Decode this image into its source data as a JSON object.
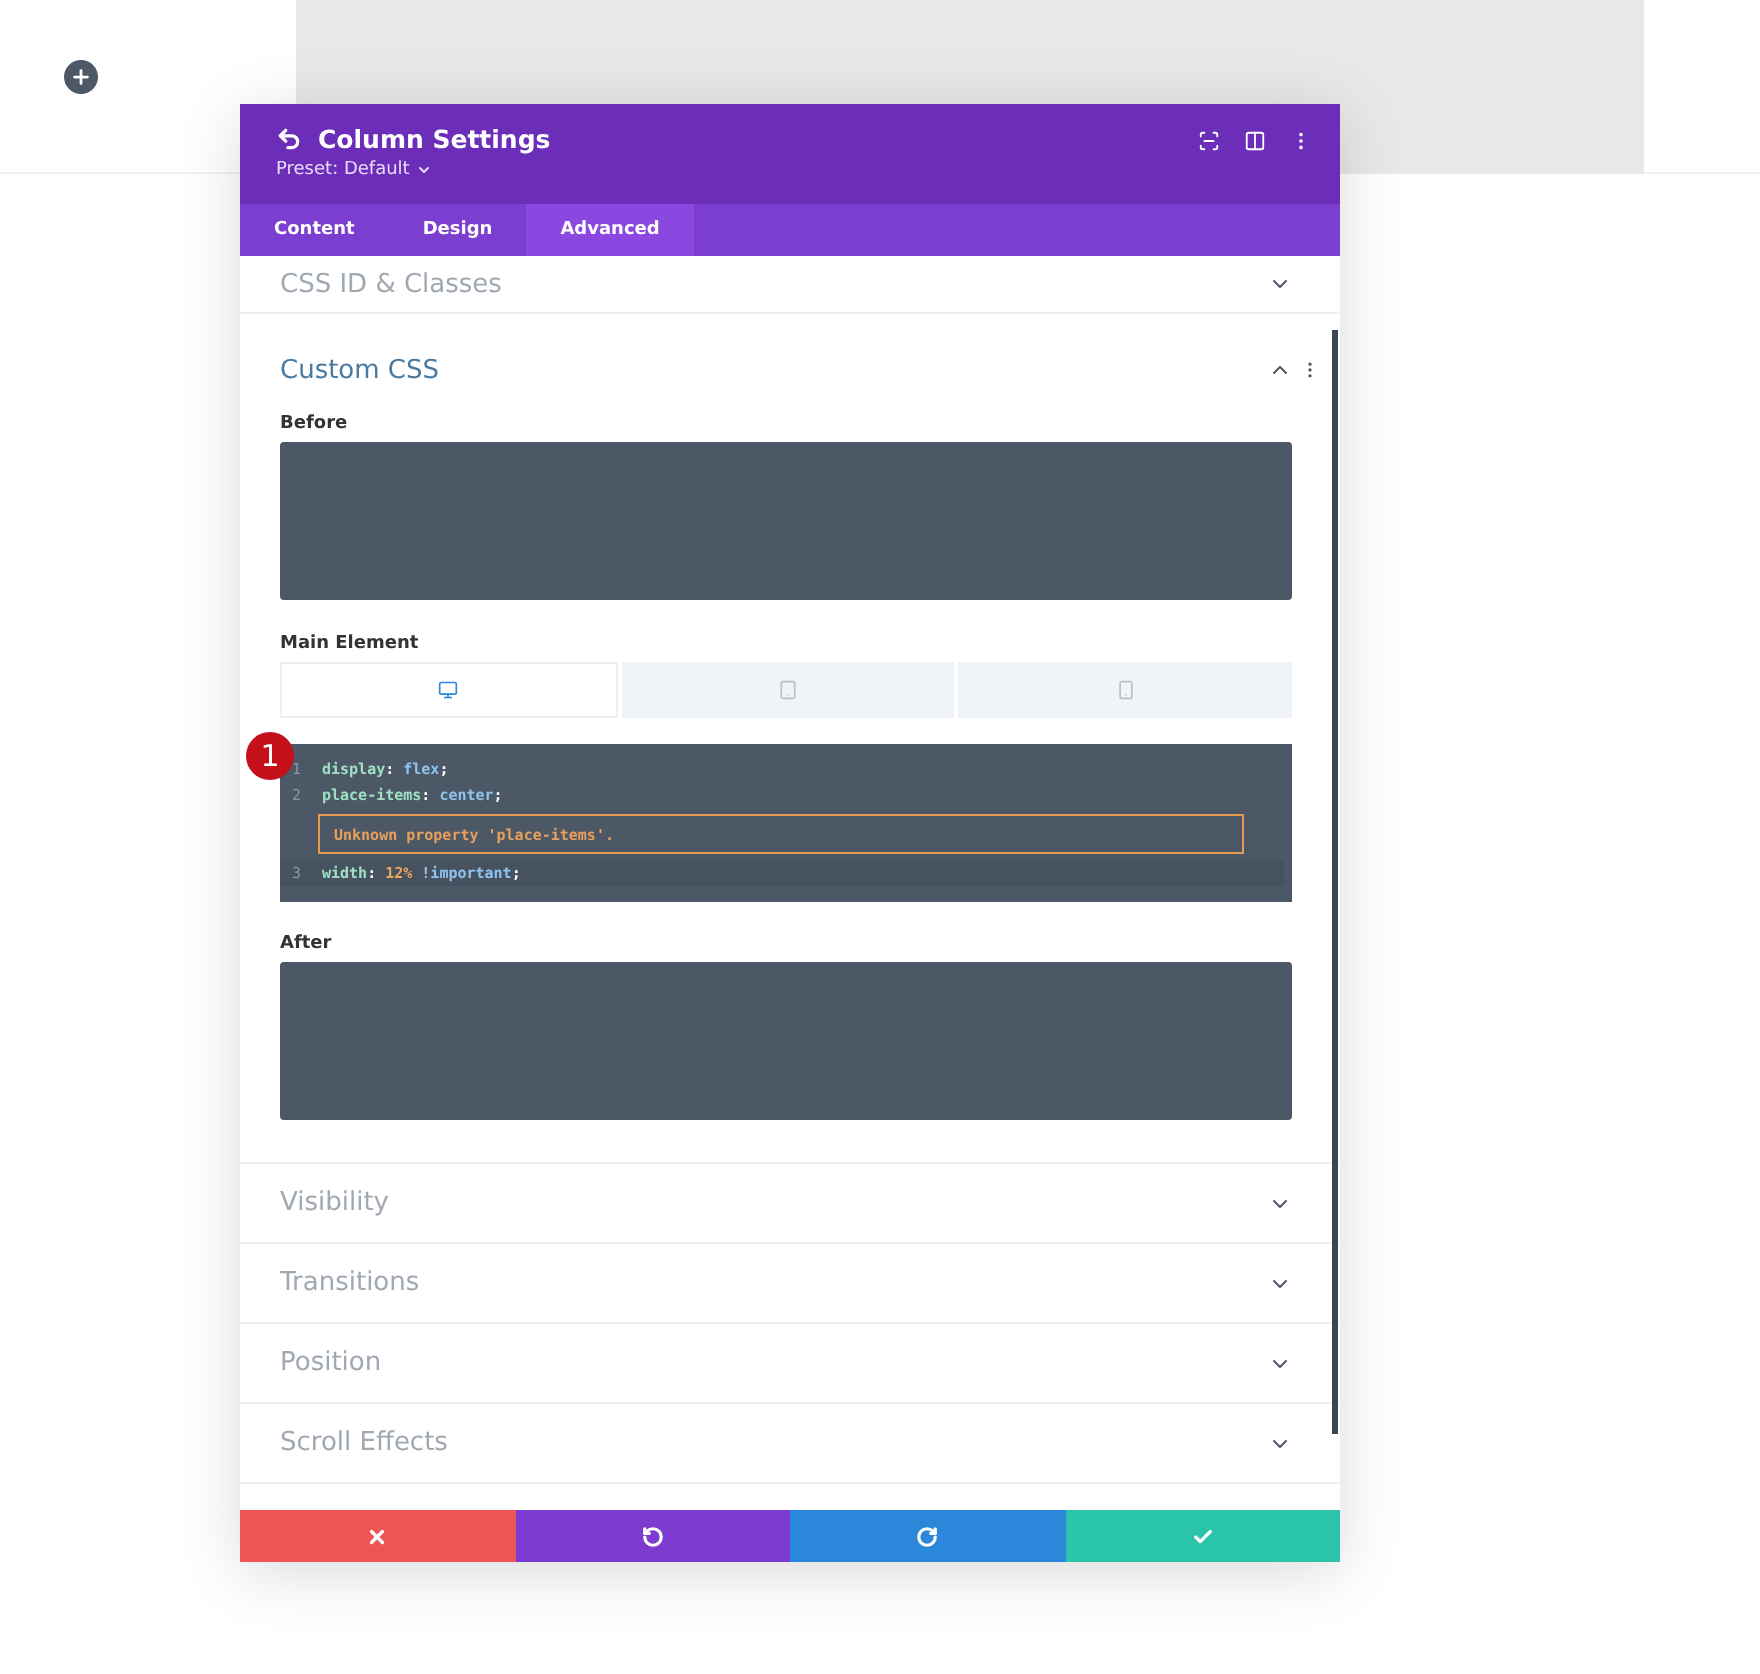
{
  "modal": {
    "title": "Column Settings",
    "preset": "Preset: Default",
    "tabs": [
      {
        "label": "Content",
        "selected": false
      },
      {
        "label": "Design",
        "selected": false
      },
      {
        "label": "Advanced",
        "selected": true
      }
    ],
    "sections_before": [
      {
        "title": "CSS ID & Classes",
        "expanded": false
      }
    ],
    "custom_css": {
      "title": "Custom CSS",
      "expanded": true,
      "before": {
        "label": "Before"
      },
      "main_element": {
        "label": "Main Element",
        "devices": [
          {
            "kind": "desktop",
            "selected": true
          },
          {
            "kind": "tablet",
            "selected": false
          },
          {
            "kind": "phone",
            "selected": false
          }
        ],
        "badge": "1",
        "lines": [
          {
            "number": "1",
            "tokens": [
              {
                "text": "display",
                "kind": "prop"
              },
              {
                "text": ": ",
                "kind": "punct"
              },
              {
                "text": "flex",
                "kind": "value"
              },
              {
                "text": ";",
                "kind": "punct"
              }
            ]
          },
          {
            "number": "2",
            "tokens": [
              {
                "text": "place-items",
                "kind": "prop"
              },
              {
                "text": ": ",
                "kind": "punct"
              },
              {
                "text": "center",
                "kind": "value"
              },
              {
                "text": ";",
                "kind": "punct"
              }
            ],
            "error": "Unknown property 'place-items'."
          },
          {
            "number": "3",
            "tokens": [
              {
                "text": "width",
                "kind": "prop"
              },
              {
                "text": ": ",
                "kind": "punct"
              },
              {
                "text": "12%",
                "kind": "number"
              },
              {
                "text": " !important",
                "kind": "value"
              },
              {
                "text": ";",
                "kind": "punct"
              }
            ],
            "active": true
          }
        ]
      },
      "after": {
        "label": "After"
      }
    },
    "sections_after": [
      {
        "title": "Visibility",
        "expanded": false
      },
      {
        "title": "Transitions",
        "expanded": false
      },
      {
        "title": "Position",
        "expanded": false
      },
      {
        "title": "Scroll Effects",
        "expanded": false
      }
    ],
    "footer": [
      {
        "kind": "cancel"
      },
      {
        "kind": "undo"
      },
      {
        "kind": "redo"
      },
      {
        "kind": "save"
      }
    ]
  }
}
